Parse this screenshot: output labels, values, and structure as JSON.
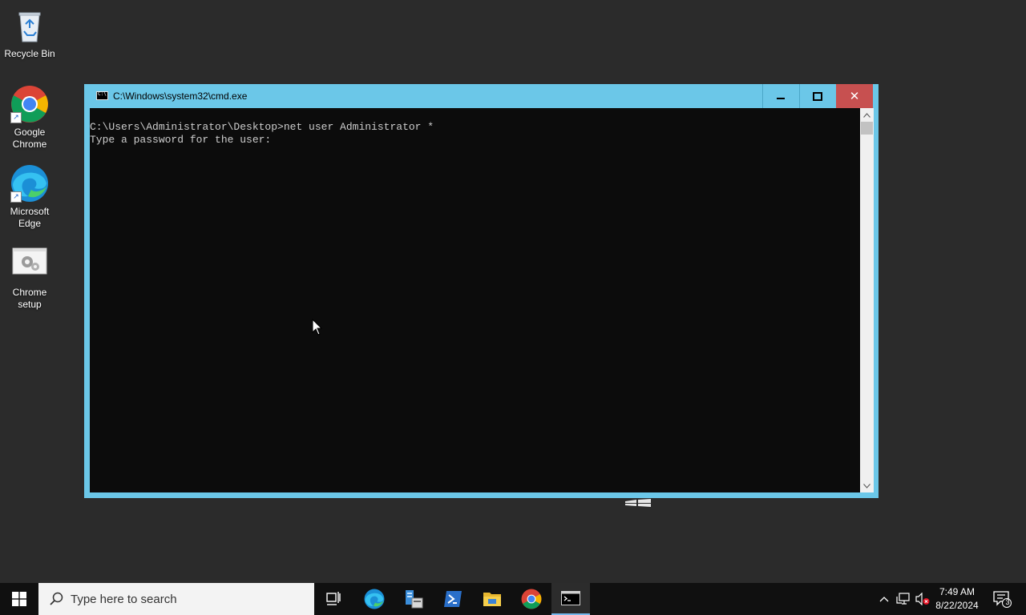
{
  "desktop": {
    "icons": [
      {
        "label": "Recycle Bin"
      },
      {
        "label": "Google Chrome"
      },
      {
        "label": "Microsoft Edge"
      },
      {
        "label": "Chrome setup"
      }
    ]
  },
  "cmd_window": {
    "title": "C:\\Windows\\system32\\cmd.exe",
    "minimize_icon": "minimize-icon",
    "maximize_icon": "maximize-icon",
    "close_label": "✕",
    "lines": [
      "C:\\Users\\Administrator\\Desktop>net user Administrator *",
      "Type a password for the user:"
    ],
    "colors": {
      "titlebar": "#6bc7e8",
      "close_button": "#c75050",
      "console_bg": "#0c0c0c",
      "console_text": "#cccccc"
    }
  },
  "taskbar": {
    "search_placeholder": "Type here to search",
    "apps": [
      {
        "name": "task-view-icon"
      },
      {
        "name": "edge-icon"
      },
      {
        "name": "server-manager-icon"
      },
      {
        "name": "powershell-icon"
      },
      {
        "name": "file-explorer-icon"
      },
      {
        "name": "chrome-icon"
      },
      {
        "name": "cmd-icon",
        "active": true
      }
    ],
    "tray": {
      "time": "7:49 AM",
      "date": "8/22/2024",
      "notification_count": "3"
    }
  }
}
